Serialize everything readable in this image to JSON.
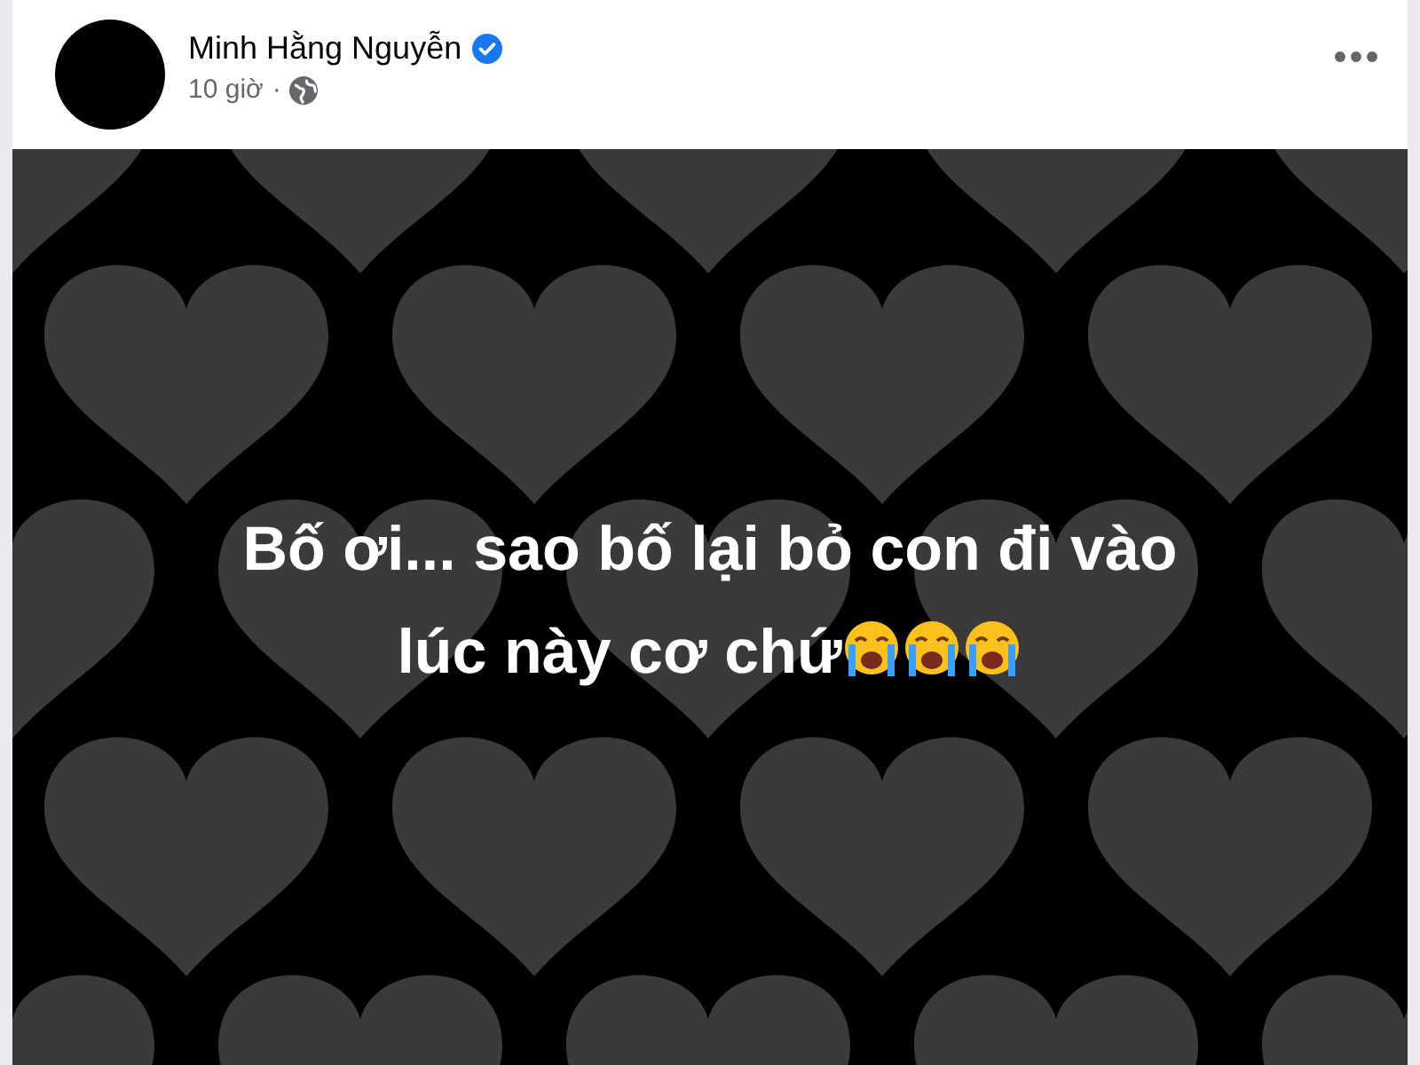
{
  "post": {
    "author": "Minh Hằng Nguyễn",
    "verified": true,
    "time": "10 giờ",
    "separator": "·",
    "text_lines": [
      "Bố ơi... sao bố lại bỏ con đi vào",
      "lúc này cơ chứ"
    ]
  }
}
